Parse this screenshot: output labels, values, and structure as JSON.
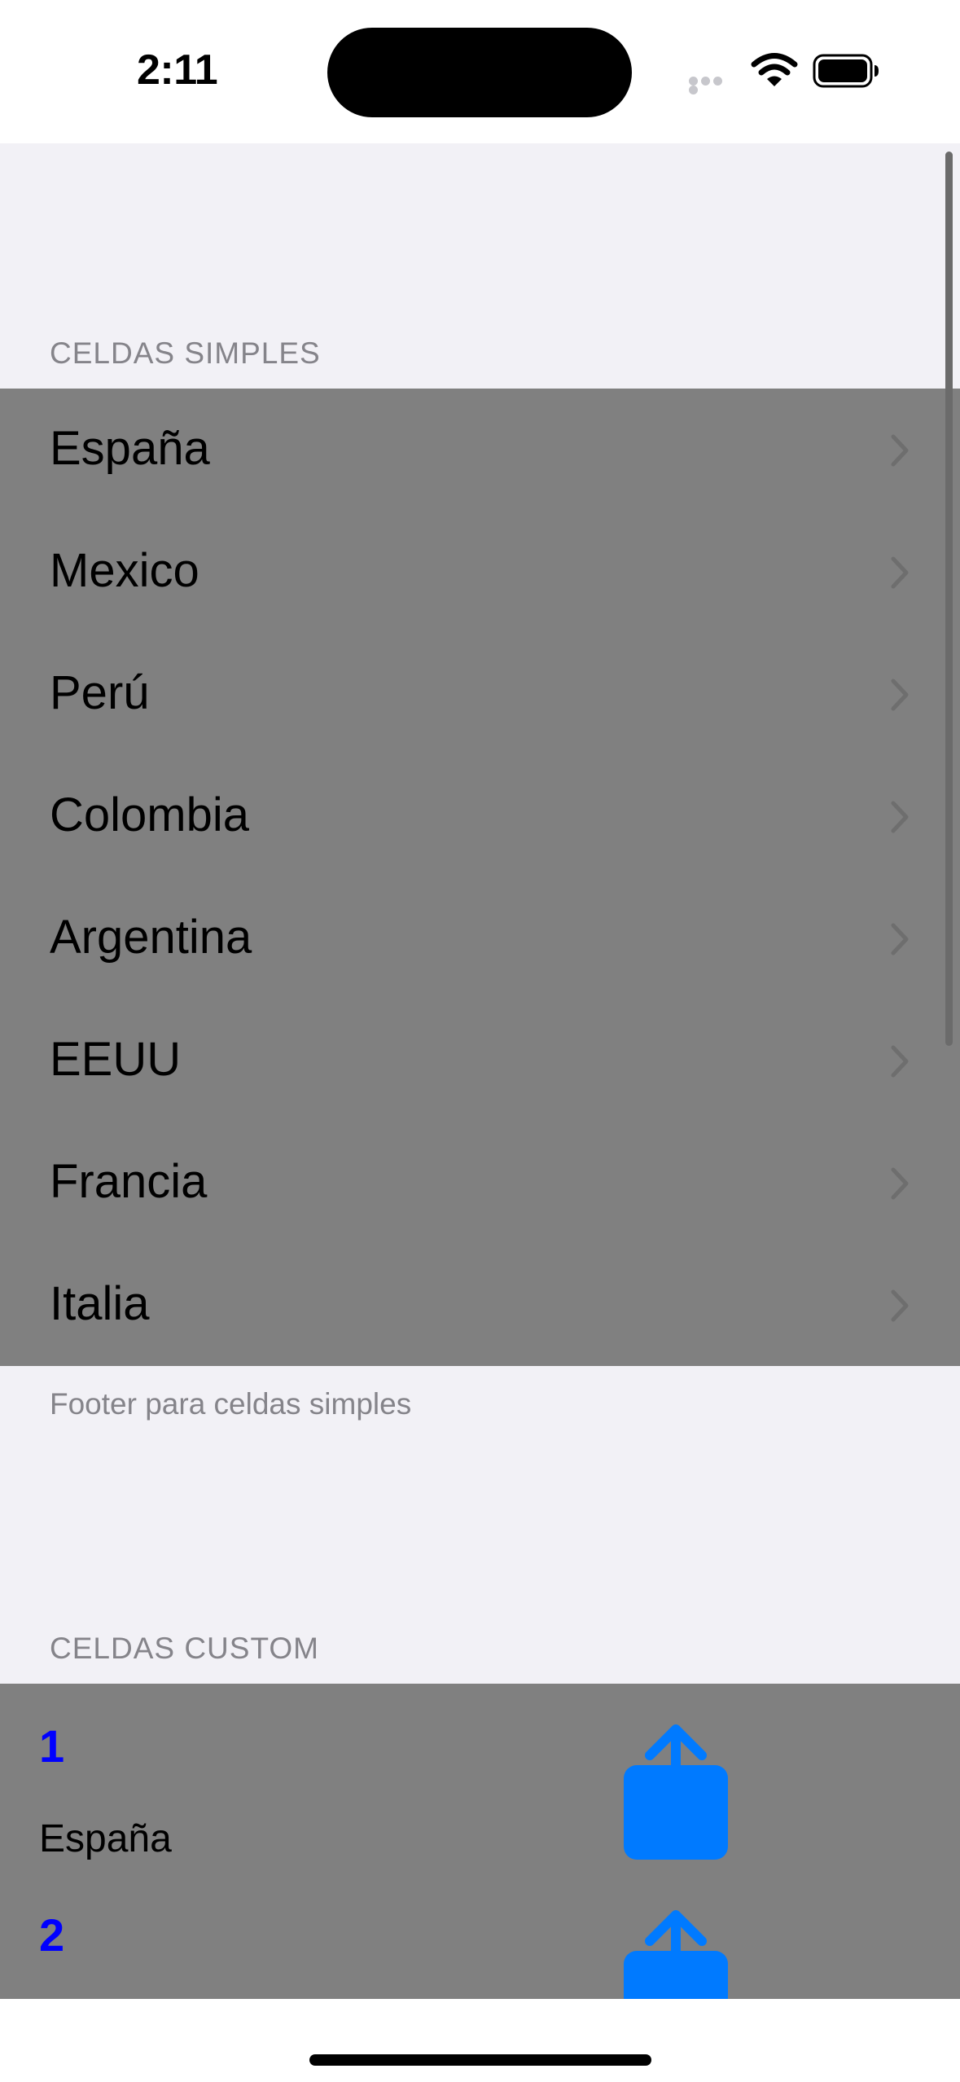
{
  "status_bar": {
    "time": "2:11",
    "icons": [
      "cellular-signal-icon",
      "wifi-icon",
      "battery-icon"
    ]
  },
  "sections": {
    "simple": {
      "header": "CELDAS SIMPLES",
      "items": [
        {
          "label": "España"
        },
        {
          "label": "Mexico"
        },
        {
          "label": "Perú"
        },
        {
          "label": "Colombia"
        },
        {
          "label": "Argentina"
        },
        {
          "label": "EEUU"
        },
        {
          "label": "Francia"
        },
        {
          "label": "Italia"
        }
      ],
      "footer": "Footer para celdas simples"
    },
    "custom": {
      "header": "CELDAS CUSTOM",
      "items": [
        {
          "number": "1",
          "name": "España",
          "icon": "share-icon"
        },
        {
          "number": "2",
          "name": "",
          "icon": "share-icon"
        }
      ]
    }
  },
  "colors": {
    "background": "#f2f1f6",
    "cell_background": "#808080",
    "accent": "#007aff",
    "number_text": "#0000ff",
    "secondary_text": "#85848a"
  }
}
